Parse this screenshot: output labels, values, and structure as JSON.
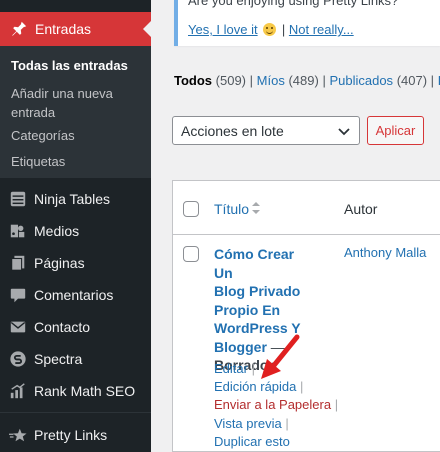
{
  "sidebar": {
    "active": {
      "label": "Entradas",
      "icon": "pin-icon"
    },
    "submenu": [
      "Todas las entradas",
      "Añadir una nueva entrada",
      "Categorías",
      "Etiquetas"
    ],
    "items": [
      {
        "label": "Ninja Tables",
        "icon": "table-icon"
      },
      {
        "label": "Medios",
        "icon": "media-icon"
      },
      {
        "label": "Páginas",
        "icon": "pages-icon"
      },
      {
        "label": "Comentarios",
        "icon": "comment-icon"
      },
      {
        "label": "Contacto",
        "icon": "envelope-icon"
      },
      {
        "label": "Spectra",
        "icon": "spectra-icon"
      },
      {
        "label": "Rank Math SEO",
        "icon": "rankmath-icon"
      },
      {
        "label": "Pretty Links",
        "icon": "star-icon"
      }
    ],
    "colors": {
      "bg": "#1d2327",
      "submenu_bg": "#2c3338",
      "active": "#d63638"
    }
  },
  "notice": {
    "question": "Are you enjoying using Pretty Links?",
    "yes_link": "Yes, I love it",
    "separator": "|",
    "no_link": "Not really..."
  },
  "filters": {
    "all": {
      "label": "Todos",
      "count": "(509)"
    },
    "mine": {
      "label": "Míos",
      "count": "(489)"
    },
    "published": {
      "label": "Publicados",
      "count": "(407)"
    },
    "next": "Bo",
    "sep": "|"
  },
  "bulk": {
    "selected": "Acciones en lote",
    "apply": "Aplicar"
  },
  "table": {
    "headers": {
      "title": "Título",
      "author": "Autor"
    },
    "row": {
      "title_lines": [
        "Cómo Crear Un",
        "Blog Privado",
        "Propio En",
        "WordPress Y",
        "Blogger"
      ],
      "dash": " —",
      "state": "Borrador",
      "author": "Anthony Malla",
      "actions": [
        "Editar",
        "Edición rápida",
        "Enviar a la Papelera",
        "Vista previa",
        "Duplicar esto"
      ],
      "pipe": "|"
    }
  },
  "colors": {
    "link": "#2271b1",
    "trash": "#b32d2e",
    "arrow": "#e02020"
  }
}
